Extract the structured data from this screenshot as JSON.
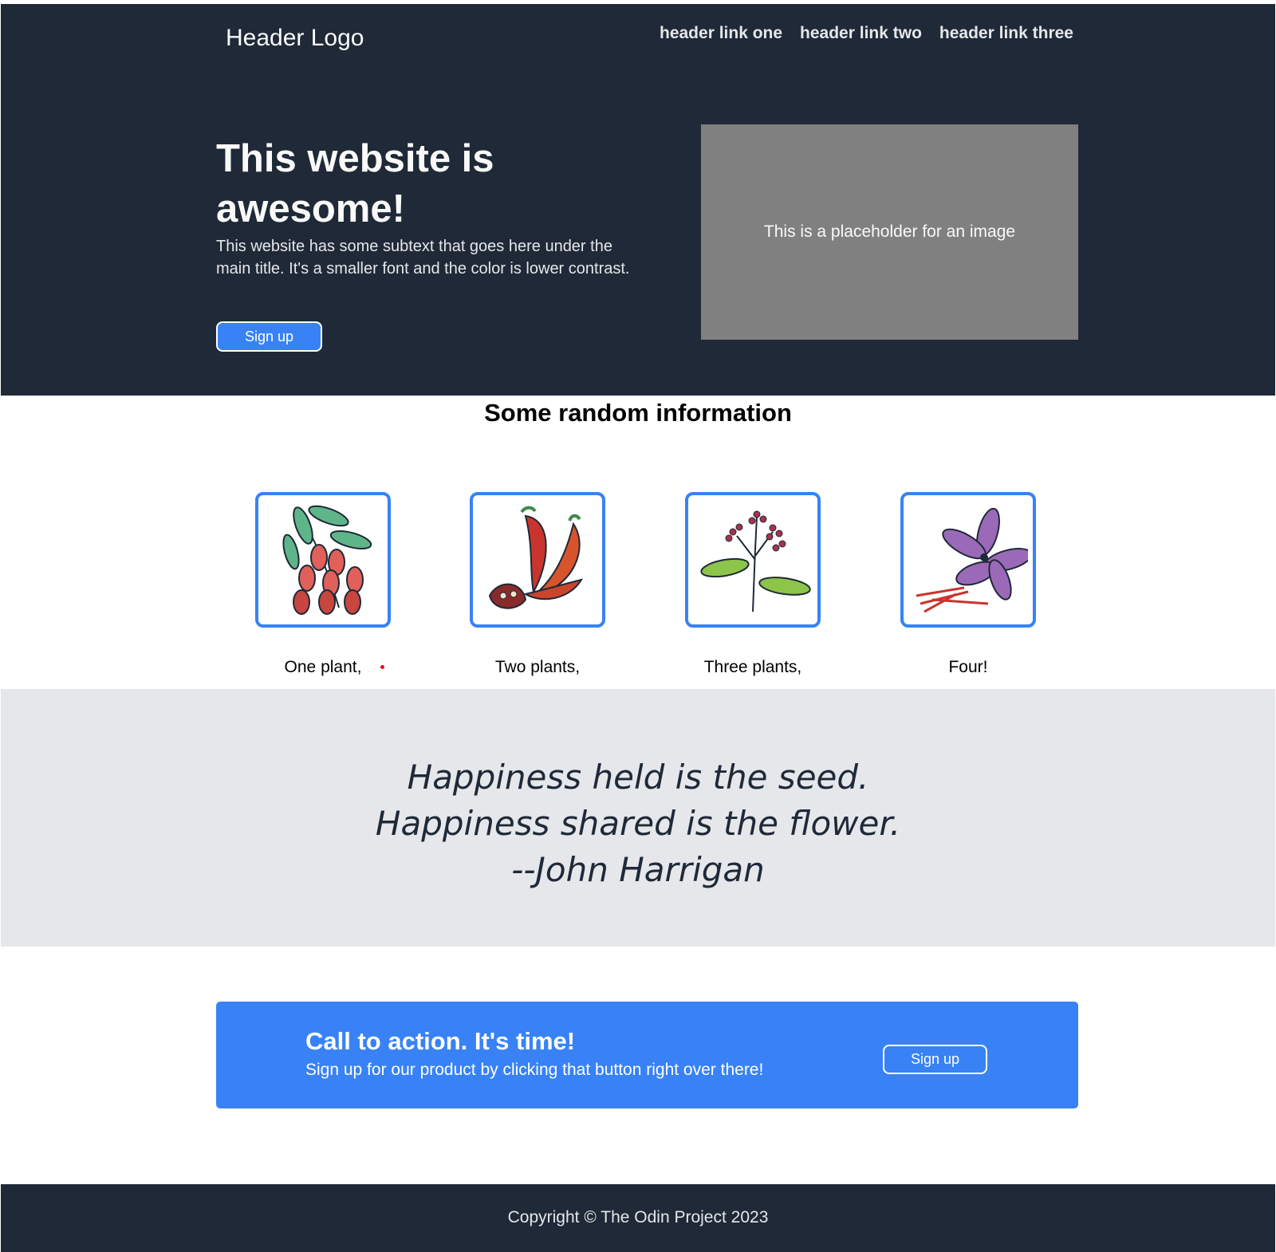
{
  "header": {
    "logo": "Header Logo",
    "links": [
      "header link one",
      "header link two",
      "header link three"
    ]
  },
  "hero": {
    "title": "This website is awesome!",
    "subtitle": "This website has some subtext that goes here under the main title. It's a smaller font and the color is lower contrast.",
    "button_label": "Sign up",
    "image_placeholder": "This is a placeholder for an image"
  },
  "info": {
    "title": "Some random information",
    "cards": [
      {
        "caption": "One plant,",
        "icon": "goji-berry-branch-icon"
      },
      {
        "caption": "Two plants,",
        "icon": "chili-pepper-icon"
      },
      {
        "caption": "Three plants,",
        "icon": "flowering-herb-icon"
      },
      {
        "caption": "Four!",
        "icon": "saffron-crocus-icon"
      }
    ]
  },
  "quote": {
    "line1": "Happiness held is the seed.",
    "line2": "Happiness shared is the flower.",
    "author": "--John Harrigan"
  },
  "cta": {
    "title": "Call to action. It's time!",
    "subtitle": "Sign up for our product by clicking that button right over there!",
    "button_label": "Sign up"
  },
  "footer": {
    "text": "Copyright © The Odin Project 2023"
  },
  "colors": {
    "dark": "#1f2937",
    "accent": "#3882f6",
    "light_gray": "#e5e7eb",
    "placeholder": "#808080"
  }
}
